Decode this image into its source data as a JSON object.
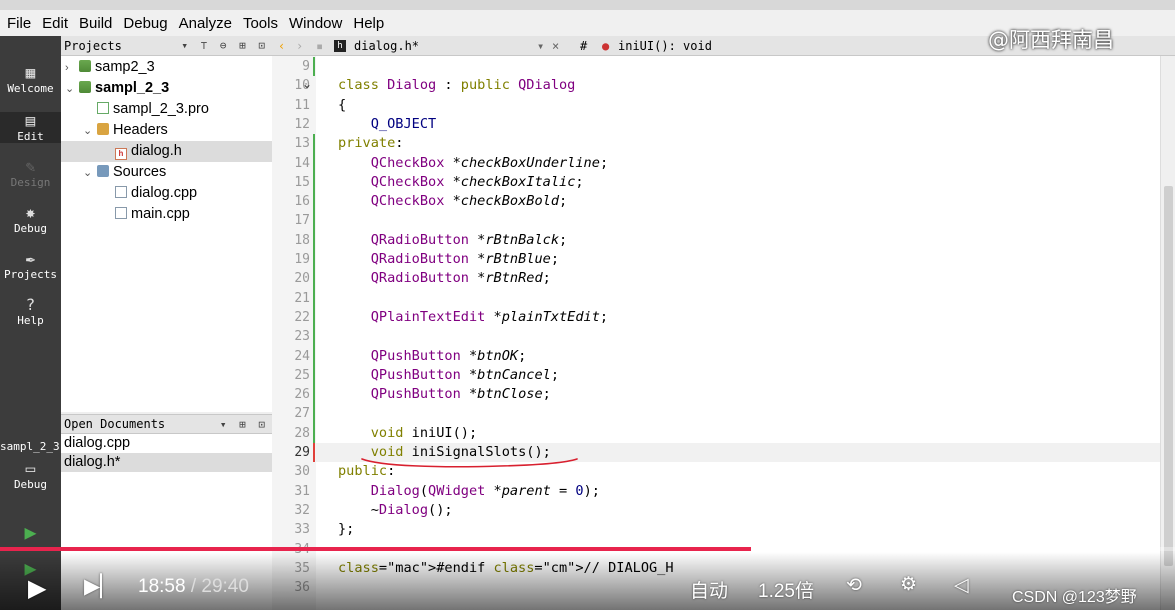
{
  "menu": [
    "File",
    "Edit",
    "Build",
    "Debug",
    "Analyze",
    "Tools",
    "Window",
    "Help"
  ],
  "modes": [
    {
      "label": "Welcome",
      "icon": "grid-icon"
    },
    {
      "label": "Edit",
      "icon": "edit-document-icon"
    },
    {
      "label": "Design",
      "icon": "pencil-icon"
    },
    {
      "label": "Debug",
      "icon": "bug-icon"
    },
    {
      "label": "Projects",
      "icon": "wrench-icon"
    },
    {
      "label": "Help",
      "icon": "help-icon"
    }
  ],
  "projects_panel": {
    "title": "Projects",
    "tree": [
      {
        "label": "samp2_3",
        "arrow": ">",
        "level": 0
      },
      {
        "label": "sampl_2_3",
        "arrow": "v",
        "level": 0,
        "bold": true
      },
      {
        "label": "sampl_2_3.pro",
        "level": 1
      },
      {
        "label": "Headers",
        "arrow": "v",
        "level": 1
      },
      {
        "label": "dialog.h",
        "level": 2,
        "selected": true
      },
      {
        "label": "Sources",
        "arrow": "v",
        "level": 1
      },
      {
        "label": "dialog.cpp",
        "level": 2
      },
      {
        "label": "main.cpp",
        "level": 2
      }
    ]
  },
  "open_documents": {
    "title": "Open Documents",
    "items": [
      "dialog.cpp",
      "dialog.h*"
    ]
  },
  "kit": {
    "project": "sampl_2_3",
    "mode": "Debug"
  },
  "editor": {
    "file_tab": "dialog.h*",
    "hash": "#",
    "symbol": "iniUI(): void",
    "close_symbol": "×"
  },
  "code": {
    "first_line": 9,
    "current_line": 29,
    "lines": [
      "",
      "class Dialog : public QDialog",
      "{",
      "    Q_OBJECT",
      "private:",
      "    QCheckBox *checkBoxUnderline;",
      "    QCheckBox *checkBoxItalic;",
      "    QCheckBox *checkBoxBold;",
      "",
      "    QRadioButton *rBtnBalck;",
      "    QRadioButton *rBtnBlue;",
      "    QRadioButton *rBtnRed;",
      "",
      "    QPlainTextEdit *plainTxtEdit;",
      "",
      "    QPushButton *btnOK;",
      "    QPushButton *btnCancel;",
      "    QPushButton *btnClose;",
      "",
      "    void iniUI();",
      "    void iniSignalSlots();",
      "public:",
      "    Dialog(QWidget *parent = 0);",
      "    ~Dialog();",
      "};",
      "",
      "#endif // DIALOG_H",
      ""
    ]
  },
  "watermarks": {
    "top": "@阿西拜南昌",
    "bottom": "CSDN @123梦野"
  },
  "video": {
    "time_current": "18:58",
    "time_separator": "/",
    "time_total": "29:40",
    "progress": 0.639,
    "quality": "自动",
    "speed": "1.25倍"
  },
  "colors": {
    "keyword": "#808000",
    "type": "#800080",
    "progress": "#e8244d"
  }
}
